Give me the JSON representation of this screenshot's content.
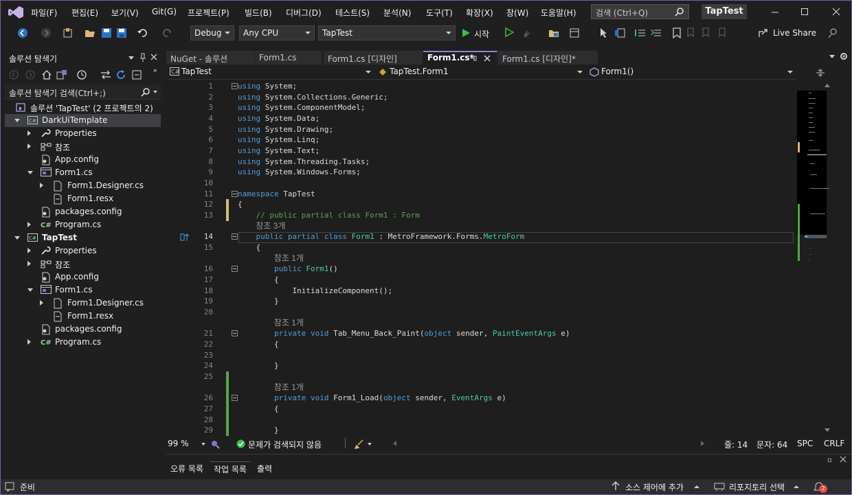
{
  "menu": [
    "파일(F)",
    "편집(E)",
    "보기(V)",
    "Git(G)",
    "프로젝트(P)",
    "빌드(B)",
    "디버그(D)",
    "테스트(S)",
    "분석(N)",
    "도구(T)",
    "확장(X)",
    "창(W)",
    "도움말(H)"
  ],
  "search": {
    "label": "검색 (Ctrl+Q)"
  },
  "app_title": "TapTest",
  "toolbar": {
    "config": "Debug",
    "platform": "Any CPU",
    "project": "TapTest",
    "start": "시작",
    "live_share": "Live Share"
  },
  "solution_explorer": {
    "title": "솔루션 탐색기",
    "search_label": "솔루션 탐색기 검색(Ctrl+;)",
    "solution_label": "솔루션 'TapTest'  (2 프로젝트의 2)",
    "tree": [
      {
        "label": "DarkUiTemplate",
        "indent": 1,
        "expand": "down",
        "icon": "csproj-icon",
        "selected": true,
        "bold": false
      },
      {
        "label": "Properties",
        "indent": 2,
        "expand": "right",
        "icon": "wrench-icon"
      },
      {
        "label": "참조",
        "indent": 2,
        "expand": "right",
        "icon": "references-icon"
      },
      {
        "label": "App.config",
        "indent": 2,
        "expand": "",
        "icon": "config-file-icon"
      },
      {
        "label": "Form1.cs",
        "indent": 2,
        "expand": "down",
        "icon": "form-icon"
      },
      {
        "label": "Form1.Designer.cs",
        "indent": 3,
        "expand": "right",
        "icon": "csharp-file-icon"
      },
      {
        "label": "Form1.resx",
        "indent": 3,
        "expand": "",
        "icon": "resx-file-icon"
      },
      {
        "label": "packages.config",
        "indent": 2,
        "expand": "",
        "icon": "config-file-icon"
      },
      {
        "label": "Program.cs",
        "indent": 2,
        "expand": "right",
        "icon": "csharp-code-icon"
      },
      {
        "label": "TapTest",
        "indent": 1,
        "expand": "down",
        "icon": "csproj-icon",
        "bold": true
      },
      {
        "label": "Properties",
        "indent": 2,
        "expand": "right",
        "icon": "wrench-icon"
      },
      {
        "label": "참조",
        "indent": 2,
        "expand": "right",
        "icon": "references-icon"
      },
      {
        "label": "App.config",
        "indent": 2,
        "expand": "",
        "icon": "config-file-icon"
      },
      {
        "label": "Form1.cs",
        "indent": 2,
        "expand": "down",
        "icon": "form-icon"
      },
      {
        "label": "Form1.Designer.cs",
        "indent": 3,
        "expand": "right",
        "icon": "csharp-file-icon"
      },
      {
        "label": "Form1.resx",
        "indent": 3,
        "expand": "",
        "icon": "resx-file-icon"
      },
      {
        "label": "packages.config",
        "indent": 2,
        "expand": "",
        "icon": "config-file-icon"
      },
      {
        "label": "Program.cs",
        "indent": 2,
        "expand": "right",
        "icon": "csharp-code-icon"
      }
    ]
  },
  "tabs": [
    {
      "label": "NuGet - 솔루션",
      "active": false
    },
    {
      "label": "Form1.cs",
      "active": false
    },
    {
      "label": "Form1.cs [디자인]",
      "active": false
    },
    {
      "label": "Form1.cs*",
      "active": true
    },
    {
      "label": "Form1.cs [디자인]*",
      "active": false
    }
  ],
  "nav": {
    "project": "TapTest",
    "type": "TapTest.Form1",
    "member": "Form1()"
  },
  "code_lines": [
    {
      "n": "1",
      "fold": true,
      "tokens": [
        [
          "kw",
          "using"
        ],
        [
          "id",
          " System;"
        ]
      ]
    },
    {
      "n": "2",
      "tokens": [
        [
          "kw",
          "using"
        ],
        [
          "id",
          " System.Collections.Generic;"
        ]
      ]
    },
    {
      "n": "3",
      "tokens": [
        [
          "kw",
          "using"
        ],
        [
          "id",
          " System.ComponentModel;"
        ]
      ]
    },
    {
      "n": "4",
      "tokens": [
        [
          "kw",
          "using"
        ],
        [
          "id",
          " System.Data;"
        ]
      ]
    },
    {
      "n": "5",
      "tokens": [
        [
          "kw",
          "using"
        ],
        [
          "id",
          " System.Drawing;"
        ]
      ]
    },
    {
      "n": "6",
      "tokens": [
        [
          "kw",
          "using"
        ],
        [
          "id",
          " System.Linq;"
        ]
      ]
    },
    {
      "n": "7",
      "tokens": [
        [
          "kw",
          "using"
        ],
        [
          "id",
          " System.Text;"
        ]
      ]
    },
    {
      "n": "8",
      "tokens": [
        [
          "kw",
          "using"
        ],
        [
          "id",
          " System.Threading.Tasks;"
        ]
      ]
    },
    {
      "n": "9",
      "tokens": [
        [
          "kw",
          "using"
        ],
        [
          "id",
          " System.Windows.Forms;"
        ]
      ]
    },
    {
      "n": "10",
      "tokens": []
    },
    {
      "n": "11",
      "fold": true,
      "tokens": [
        [
          "kw",
          "namespace"
        ],
        [
          "id",
          " TapTest"
        ]
      ]
    },
    {
      "n": "12",
      "chg": "y",
      "tokens": [
        [
          "id",
          "{"
        ]
      ]
    },
    {
      "n": "13",
      "chg": "y",
      "tokens": [
        [
          "cm",
          "    // public partial class Form1 : Form"
        ]
      ]
    },
    {
      "hint": "참조 3개",
      "indent": "    "
    },
    {
      "n": "14",
      "fold": true,
      "cur": true,
      "tokens": [
        [
          "kw",
          "    public partial class"
        ],
        [
          "ty",
          " Form1"
        ],
        [
          "id",
          " : MetroFramework.Forms."
        ],
        [
          "ty",
          "MetroForm"
        ]
      ]
    },
    {
      "n": "15",
      "tokens": [
        [
          "id",
          "    {"
        ]
      ]
    },
    {
      "hint": "참조 1개",
      "indent": "        "
    },
    {
      "n": "16",
      "fold": true,
      "tokens": [
        [
          "kw",
          "        public"
        ],
        [
          "ty",
          " Form1"
        ],
        [
          "id",
          "()"
        ]
      ]
    },
    {
      "n": "17",
      "tokens": [
        [
          "id",
          "        {"
        ]
      ]
    },
    {
      "n": "18",
      "tokens": [
        [
          "id",
          "            InitializeComponent();"
        ]
      ]
    },
    {
      "n": "19",
      "tokens": [
        [
          "id",
          "        }"
        ]
      ]
    },
    {
      "n": "20",
      "tokens": []
    },
    {
      "hint": "참조 1개",
      "indent": "        "
    },
    {
      "n": "21",
      "fold": true,
      "tokens": [
        [
          "kw",
          "        private void"
        ],
        [
          "id",
          " Tab_Menu_Back_Paint("
        ],
        [
          "kw",
          "object"
        ],
        [
          "id",
          " sender, "
        ],
        [
          "ty",
          "PaintEventArgs"
        ],
        [
          "id",
          " e)"
        ]
      ]
    },
    {
      "n": "22",
      "tokens": [
        [
          "id",
          "        {"
        ]
      ]
    },
    {
      "n": "23",
      "tokens": []
    },
    {
      "n": "24",
      "tokens": [
        [
          "id",
          "        }"
        ]
      ]
    },
    {
      "n": "25",
      "chg": "g",
      "tokens": []
    },
    {
      "hint": "참조 1개",
      "indent": "        ",
      "chg": "g"
    },
    {
      "n": "26",
      "fold": true,
      "chg": "g",
      "tokens": [
        [
          "kw",
          "        private void"
        ],
        [
          "id",
          " Form1_Load("
        ],
        [
          "kw",
          "object"
        ],
        [
          "id",
          " sender, "
        ],
        [
          "ty",
          "EventArgs"
        ],
        [
          "id",
          " e)"
        ]
      ]
    },
    {
      "n": "27",
      "chg": "g",
      "tokens": [
        [
          "id",
          "        {"
        ]
      ]
    },
    {
      "n": "28",
      "chg": "g",
      "tokens": []
    },
    {
      "n": "29",
      "chg": "g",
      "tokens": [
        [
          "id",
          "        }"
        ]
      ]
    }
  ],
  "editor_status": {
    "zoom": "99 %",
    "issues": "문제가 검색되지 않음",
    "line": "줄: 14",
    "col": "문자: 64",
    "spc": "SPC",
    "crlf": "CRLF"
  },
  "bottom_tabs": [
    {
      "label": "오류 목록",
      "active": false
    },
    {
      "label": "작업 목록",
      "active": true
    },
    {
      "label": "출력",
      "active": false
    }
  ],
  "status": {
    "ready": "준비",
    "source_control": "소스 제어에 추가",
    "repo": "리포지토리 선택",
    "notifications": "2"
  },
  "colors": {
    "accent": "#9d7ecf",
    "keyword": "#569cd6",
    "type": "#4ec9b0",
    "comment": "#57a64a",
    "change_saved": "#57a64a",
    "change_unsaved": "#d7ba7d"
  }
}
